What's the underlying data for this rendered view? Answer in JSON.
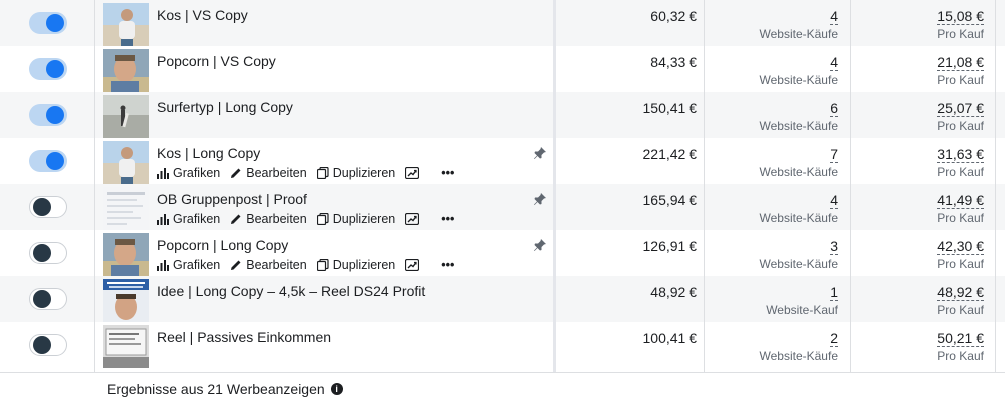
{
  "rows": [
    {
      "active": true,
      "name": "Kos | VS Copy",
      "spend": "60,32 €",
      "results": "4",
      "results_label": "Website-Käufe",
      "cost": "15,08 €",
      "cost_label": "Pro Kauf",
      "thumb": "beach-person",
      "shaded": true,
      "hover_actions": false
    },
    {
      "active": true,
      "name": "Popcorn | VS Copy",
      "spend": "84,33 €",
      "results": "4",
      "results_label": "Website-Käufe",
      "cost": "21,08 €",
      "cost_label": "Pro Kauf",
      "thumb": "selfie",
      "shaded": false,
      "hover_actions": false
    },
    {
      "active": true,
      "name": "Surfertyp | Long Copy",
      "spend": "150,41 €",
      "results": "6",
      "results_label": "Website-Käufe",
      "cost": "25,07 €",
      "cost_label": "Pro Kauf",
      "thumb": "surfer",
      "shaded": true,
      "hover_actions": false
    },
    {
      "active": true,
      "name": "Kos | Long Copy",
      "spend": "221,42 €",
      "results": "7",
      "results_label": "Website-Käufe",
      "cost": "31,63 €",
      "cost_label": "Pro Kauf",
      "thumb": "beach-person",
      "shaded": false,
      "hover_actions": true
    },
    {
      "active": false,
      "name": "OB Gruppenpost | Proof",
      "spend": "165,94 €",
      "results": "4",
      "results_label": "Website-Käufe",
      "cost": "41,49 €",
      "cost_label": "Pro Kauf",
      "thumb": "document",
      "shaded": true,
      "hover_actions": true
    },
    {
      "active": false,
      "name": "Popcorn | Long Copy",
      "spend": "126,91 €",
      "results": "3",
      "results_label": "Website-Käufe",
      "cost": "42,30 €",
      "cost_label": "Pro Kauf",
      "thumb": "selfie",
      "shaded": false,
      "hover_actions": true
    },
    {
      "active": false,
      "name": "Idee | Long Copy – 4,5k – Reel DS24 Profit",
      "spend": "48,92 €",
      "results": "1",
      "results_label": "Website-Kauf",
      "cost": "48,92 €",
      "cost_label": "Pro Kauf",
      "thumb": "reel",
      "shaded": true,
      "hover_actions": false
    },
    {
      "active": false,
      "name": "Reel | Passives Einkommen",
      "spend": "100,41 €",
      "results": "2",
      "results_label": "Website-Käufe",
      "cost": "50,21 €",
      "cost_label": "Pro Kauf",
      "thumb": "screen",
      "shaded": false,
      "hover_actions": false
    }
  ],
  "actions": {
    "charts_label": "Grafiken",
    "edit_label": "Bearbeiten",
    "duplicate_label": "Duplizieren",
    "more_label": "•••"
  },
  "footer": {
    "summary": "Ergebnisse aus 21 Werbeanzeigen",
    "info_icon": "i"
  },
  "colors": {
    "toggle_on": "#1877f2",
    "toggle_off_knob": "#283845",
    "row_shade": "#f5f6f7"
  }
}
